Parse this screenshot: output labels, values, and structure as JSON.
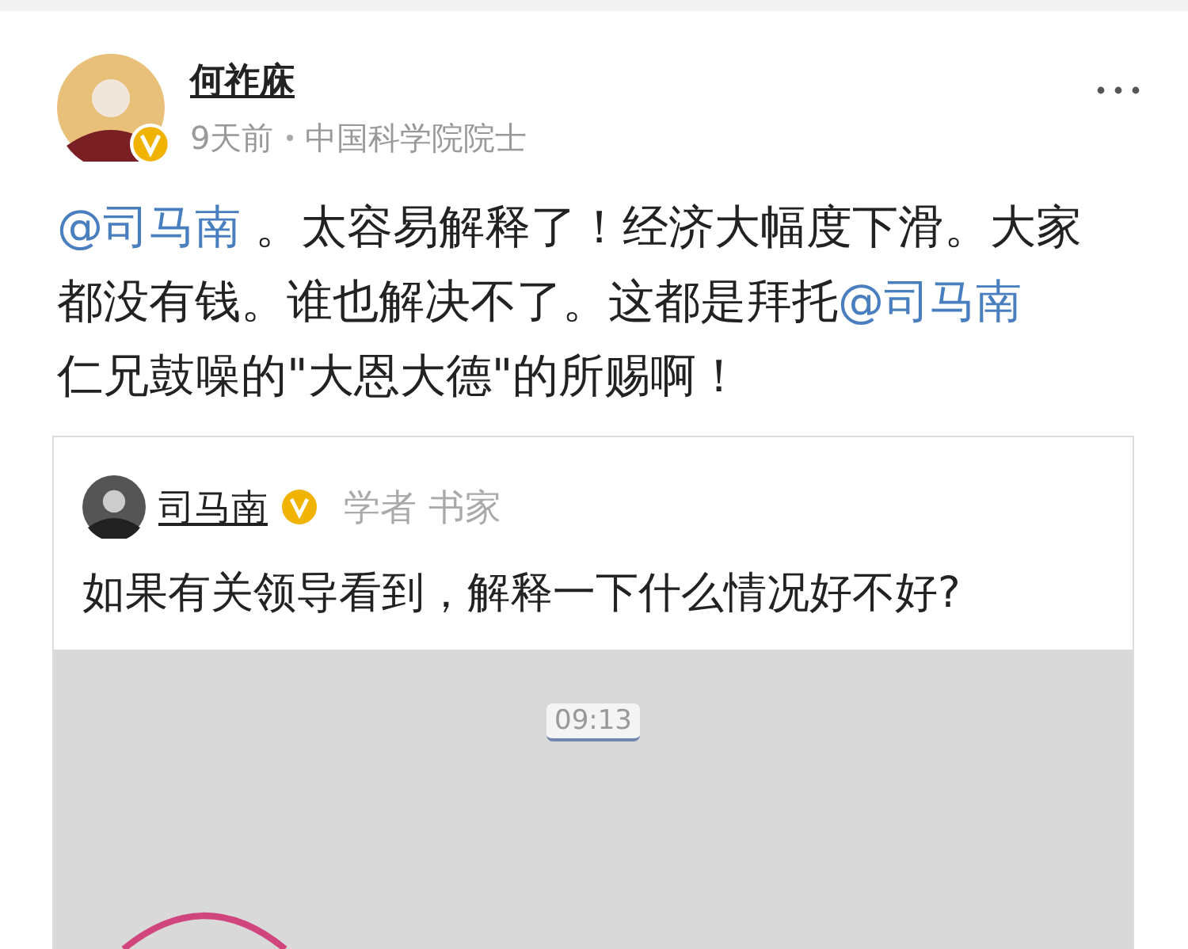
{
  "post": {
    "author": {
      "name": "何祚庥",
      "verified": true
    },
    "time": "9天前",
    "source": "中国科学院院士",
    "body": [
      {
        "kind": "mention",
        "text": "@司马南"
      },
      {
        "kind": "text",
        "text": " 。太容易解释了！经济大幅度下滑。大家都没有钱。谁也解决不了。这都是拜托"
      },
      {
        "kind": "mention",
        "text": "@司马南"
      },
      {
        "kind": "text",
        "text": "　　仁兄鼓噪的\"大恩大德\"的所赐啊！"
      }
    ],
    "quote": {
      "author": {
        "name": "司马南",
        "verified": true
      },
      "tags": "学者 书家",
      "text": "如果有关领导看到，解释一下什么情况好不好?",
      "screenshot": {
        "time": "09:13"
      }
    }
  }
}
